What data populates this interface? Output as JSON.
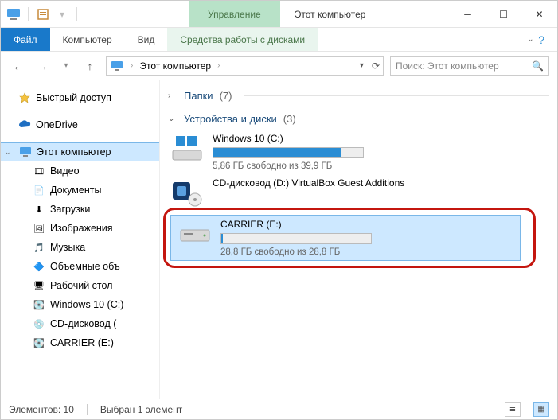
{
  "titlebar": {
    "context_tab": "Управление",
    "title": "Этот компьютер"
  },
  "ribbon": {
    "file": "Файл",
    "tabs": [
      "Компьютер",
      "Вид"
    ],
    "context_tab": "Средства работы с дисками"
  },
  "address": {
    "text": "Этот компьютер"
  },
  "search": {
    "placeholder": "Поиск: Этот компьютер"
  },
  "tree": {
    "quick": "Быстрый доступ",
    "onedrive": "OneDrive",
    "thispc": "Этот компьютер",
    "children": [
      "Видео",
      "Документы",
      "Загрузки",
      "Изображения",
      "Музыка",
      "Объемные объ",
      "Рабочий стол",
      "Windows 10 (C:)",
      "CD-дисковод (",
      "CARRIER (E:)"
    ]
  },
  "groups": {
    "folders": {
      "label": "Папки",
      "count": "(7)"
    },
    "drives": {
      "label": "Устройства и диски",
      "count": "(3)"
    }
  },
  "drives": [
    {
      "name": "Windows 10 (C:)",
      "free": "5,86 ГБ свободно из 39,9 ГБ",
      "fill_pct": 85
    },
    {
      "name": "CD-дисковод (D:) VirtualBox Guest Additions",
      "free": "",
      "fill_pct": 0
    },
    {
      "name": "CARRIER (E:)",
      "free": "28,8 ГБ свободно из 28,8 ГБ",
      "fill_pct": 1
    }
  ],
  "status": {
    "items": "Элементов: 10",
    "selected": "Выбран 1 элемент"
  }
}
